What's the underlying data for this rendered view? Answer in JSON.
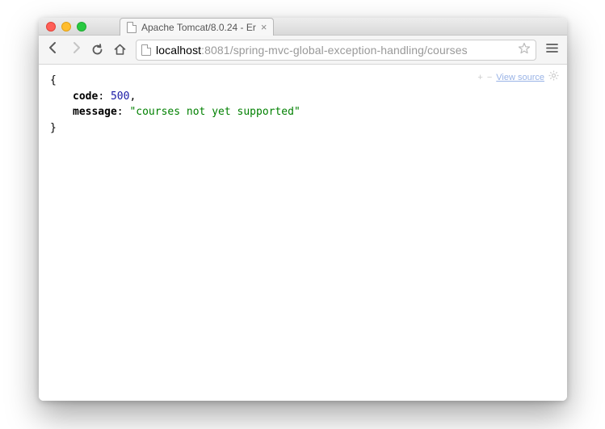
{
  "tab": {
    "title": "Apache Tomcat/8.0.24 - Er"
  },
  "address": {
    "host": "localhost",
    "port": ":8081",
    "path": "/spring-mvc-global-exception-handling/courses"
  },
  "viewer": {
    "plus": "+",
    "minus": "−",
    "view_source_label": "View source"
  },
  "json": {
    "open_brace": "{",
    "close_brace": "}",
    "code_key": "code",
    "code_value": "500",
    "comma": ",",
    "colon": ": ",
    "message_key": "message",
    "message_value": "\"courses not yet supported\""
  }
}
